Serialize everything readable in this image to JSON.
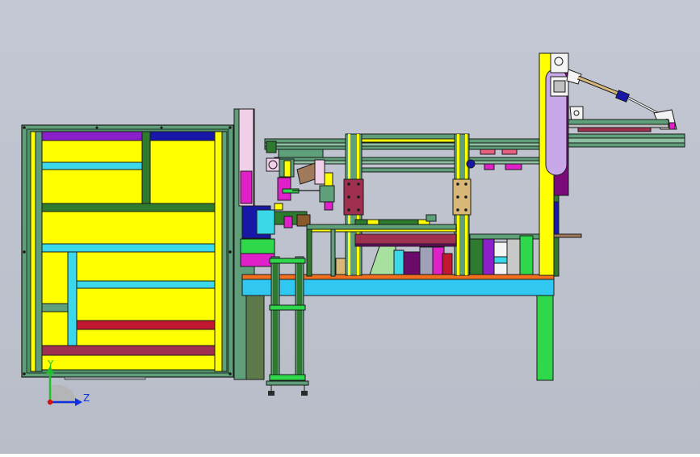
{
  "viewport": {
    "background_top": "#c4c8d4",
    "background_bottom": "#b9bdc8"
  },
  "triad": {
    "y_label": "Y",
    "z_label": "Z",
    "y_color": "#1fbf2a",
    "z_color": "#1030e0",
    "origin_color": "#d81010"
  },
  "palette": {
    "outline": "#1a1a1a",
    "yellow": "#ffff00",
    "frame_green": "#5fa07a",
    "bright_green": "#2fd84a",
    "dark_green": "#2e7a2e",
    "cyan": "#3ad8e8",
    "purple": "#8b1fc9",
    "navy": "#1818a8",
    "magenta": "#e020c8",
    "olive": "#8c9a2a",
    "orange": "#f07020",
    "sky": "#30c8f0",
    "maroon": "#a03050",
    "crimson": "#c01830",
    "brown": "#8a5a2a",
    "grey": "#8a8a8a",
    "white": "#f4f4f4",
    "dark_purple": "#6a0a6a",
    "tan": "#d8b878",
    "lime": "#a8e020"
  }
}
